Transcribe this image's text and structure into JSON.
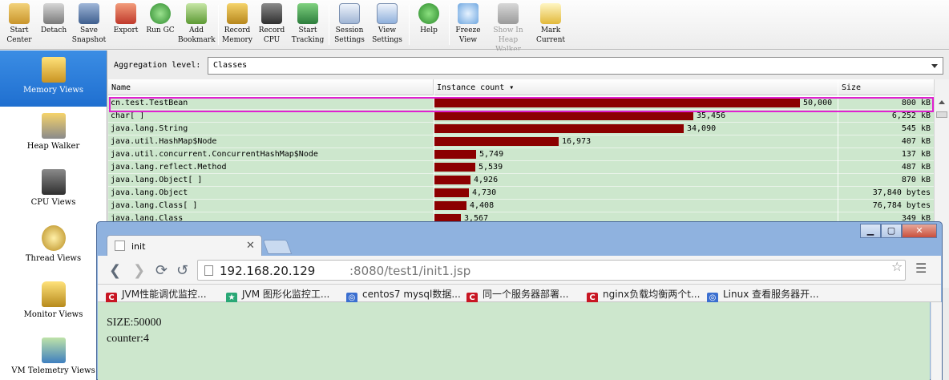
{
  "toolbar": {
    "buttons": [
      {
        "line1": "Start",
        "line2": "Center",
        "icon": "start-center-icon"
      },
      {
        "line1": "Detach",
        "line2": "",
        "icon": "detach-icon"
      },
      {
        "line1": "Save",
        "line2": "Snapshot",
        "icon": "save-snapshot-icon"
      },
      {
        "line1": "Export",
        "line2": "",
        "icon": "export-icon"
      },
      {
        "line1": "Run GC",
        "line2": "",
        "icon": "run-gc-icon"
      },
      {
        "line1": "Add",
        "line2": "Bookmark",
        "icon": "add-bookmark-icon"
      },
      {
        "line1": "Record",
        "line2": "Memory",
        "icon": "record-memory-icon"
      },
      {
        "line1": "Record",
        "line2": "CPU",
        "icon": "record-cpu-icon"
      },
      {
        "line1": "Start",
        "line2": "Tracking",
        "icon": "start-tracking-icon"
      },
      {
        "line1": "Session",
        "line2": "Settings",
        "icon": "session-settings-icon"
      },
      {
        "line1": "View",
        "line2": "Settings",
        "icon": "view-settings-icon"
      },
      {
        "line1": "Help",
        "line2": "",
        "icon": "help-icon"
      },
      {
        "line1": "Freeze",
        "line2": "View",
        "icon": "freeze-view-icon"
      },
      {
        "line1": "Show In",
        "line2": "Heap Walker",
        "icon": "show-in-heap-walker-icon"
      },
      {
        "line1": "Mark",
        "line2": "Current",
        "icon": "mark-current-icon"
      }
    ]
  },
  "sidebar": {
    "items": [
      {
        "label": "Memory Views",
        "icon": "memory-views-icon",
        "active": true
      },
      {
        "label": "Heap Walker",
        "icon": "heap-walker-icon"
      },
      {
        "label": "CPU Views",
        "icon": "cpu-views-icon"
      },
      {
        "label": "Thread Views",
        "icon": "thread-views-icon"
      },
      {
        "label": "Monitor Views",
        "icon": "monitor-views-icon"
      },
      {
        "label": "VM Telemetry Views",
        "icon": "vm-telemetry-views-icon"
      }
    ]
  },
  "aggregation": {
    "label": "Aggregation level:",
    "value": "Classes"
  },
  "table": {
    "headers": {
      "name": "Name",
      "count": "Instance count ▾",
      "size": "Size"
    },
    "bar_color": "#8b0000",
    "highlight_color": "#e020d0",
    "rows": [
      {
        "name": "cn.test.TestBean",
        "count": 50000,
        "count_text": "50,000",
        "size": "800 kB"
      },
      {
        "name": "char[ ]",
        "count": 35456,
        "count_text": "35,456",
        "size": "6,252 kB"
      },
      {
        "name": "java.lang.String",
        "count": 34090,
        "count_text": "34,090",
        "size": "545 kB"
      },
      {
        "name": "java.util.HashMap$Node",
        "count": 16973,
        "count_text": "16,973",
        "size": "407 kB"
      },
      {
        "name": "java.util.concurrent.ConcurrentHashMap$Node",
        "count": 5749,
        "count_text": "5,749",
        "size": "137 kB"
      },
      {
        "name": "java.lang.reflect.Method",
        "count": 5539,
        "count_text": "5,539",
        "size": "487 kB"
      },
      {
        "name": "java.lang.Object[ ]",
        "count": 4926,
        "count_text": "4,926",
        "size": "870 kB"
      },
      {
        "name": "java.lang.Object",
        "count": 4730,
        "count_text": "4,730",
        "size": "37,840 bytes"
      },
      {
        "name": "java.lang.Class[ ]",
        "count": 4408,
        "count_text": "4,408",
        "size": "76,784 bytes"
      },
      {
        "name": "java.lang.Class",
        "count": 3567,
        "count_text": "3,567",
        "size": "349 kB"
      }
    ]
  },
  "browser": {
    "tab_title": "init",
    "url_host": "192.168.20.129",
    "url_rest": ":8080/test1/init1.jsp",
    "bookmarks": [
      {
        "label": "JVM性能调优监控...",
        "icon": "csdn-icon",
        "color": "#c81623",
        "glyph": "C"
      },
      {
        "label": "JVM 图形化监控工...",
        "icon": "site-icon",
        "color": "#2aa876",
        "glyph": "★"
      },
      {
        "label": "centos7 mysql数据...",
        "icon": "globe-icon",
        "color": "#3b6fd0",
        "glyph": "◎"
      },
      {
        "label": "同一个服务器部署...",
        "icon": "csdn-icon",
        "color": "#c81623",
        "glyph": "C"
      },
      {
        "label": "nginx负载均衡两个t...",
        "icon": "csdn-icon",
        "color": "#c81623",
        "glyph": "C"
      },
      {
        "label": "Linux 查看服务器开...",
        "icon": "globe-icon",
        "color": "#3b6fd0",
        "glyph": "◎"
      }
    ],
    "page_lines": [
      "SIZE:50000",
      "counter:4"
    ]
  }
}
